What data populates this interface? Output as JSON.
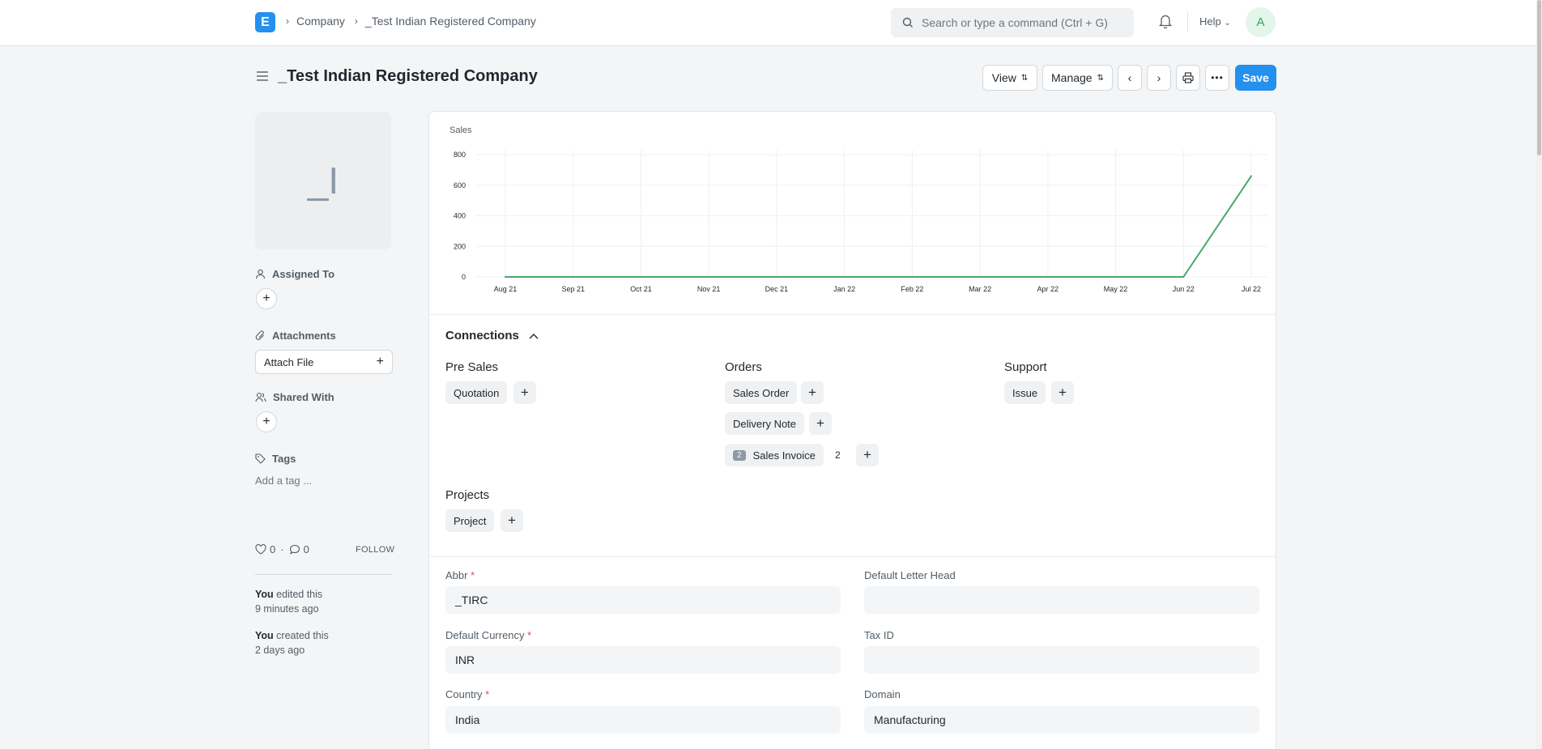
{
  "navbar": {
    "logo_letter": "E",
    "breadcrumbs": [
      "Company",
      "_Test Indian Registered Company"
    ],
    "search_placeholder": "Search or type a command (Ctrl + G)",
    "help_label": "Help",
    "avatar_letter": "A"
  },
  "page": {
    "title": "_Test Indian Registered Company",
    "buttons": {
      "view": "View",
      "manage": "Manage",
      "save": "Save"
    }
  },
  "sidebar": {
    "image_placeholder": "_I",
    "assigned_to": "Assigned To",
    "attachments": "Attachments",
    "attach_file": "Attach File",
    "shared_with": "Shared With",
    "tags": "Tags",
    "add_tag": "Add a tag ...",
    "likes": "0",
    "comments": "0",
    "follow": "FOLLOW",
    "activity": [
      {
        "who": "You",
        "what": "edited this",
        "when": "9 minutes ago"
      },
      {
        "who": "You",
        "what": "created this",
        "when": "2 days ago"
      }
    ]
  },
  "chart_data": {
    "type": "line",
    "title": "Sales",
    "categories": [
      "Aug 21",
      "Sep 21",
      "Oct 21",
      "Nov 21",
      "Dec 21",
      "Jan 22",
      "Feb 22",
      "Mar 22",
      "Apr 22",
      "May 22",
      "Jun 22",
      "Jul 22"
    ],
    "series": [
      {
        "values": [
          0,
          0,
          0,
          0,
          0,
          0,
          0,
          0,
          0,
          0,
          0,
          660
        ]
      }
    ],
    "yticks": [
      0,
      200,
      400,
      600,
      800
    ],
    "ylim": [
      0,
      800
    ],
    "color": "#48a86a",
    "grid": true
  },
  "connections": {
    "title": "Connections",
    "groups": {
      "pre_sales": {
        "label": "Pre Sales",
        "items": [
          "Quotation"
        ]
      },
      "orders": {
        "label": "Orders",
        "items": [
          "Sales Order",
          "Delivery Note",
          "Sales Invoice"
        ],
        "sales_invoice_badge": "2",
        "sales_invoice_count": "2"
      },
      "support": {
        "label": "Support",
        "items": [
          "Issue"
        ]
      },
      "projects": {
        "label": "Projects",
        "items": [
          "Project"
        ]
      }
    }
  },
  "fields": {
    "abbr": {
      "label": "Abbr",
      "value": "_TIRC"
    },
    "default_letter_head": {
      "label": "Default Letter Head",
      "value": ""
    },
    "default_currency": {
      "label": "Default Currency",
      "value": "INR"
    },
    "tax_id": {
      "label": "Tax ID",
      "value": ""
    },
    "country": {
      "label": "Country",
      "value": "India"
    },
    "domain": {
      "label": "Domain",
      "value": "Manufacturing"
    }
  }
}
